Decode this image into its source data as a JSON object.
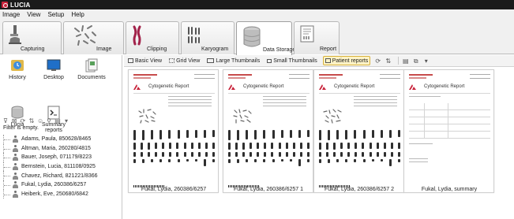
{
  "window": {
    "title": "LUCIA"
  },
  "menu": [
    "Image",
    "View",
    "Setup",
    "Help"
  ],
  "modules": [
    {
      "label": "Capturing",
      "icon": "microscope-icon"
    },
    {
      "label": "Image",
      "icon": "chromosome-spread-icon"
    },
    {
      "label": "Clipping",
      "icon": "chromosome-icon"
    },
    {
      "label": "Karyogram",
      "icon": "karyogram-icon"
    },
    {
      "label": "Data Storage",
      "icon": "database-icon",
      "active": true
    },
    {
      "label": "Report",
      "icon": "report-icon"
    }
  ],
  "toolbar": {
    "views": [
      "Basic View",
      "Grid View",
      "Large Thumbnails",
      "Small Thumbnails",
      "Patient reports"
    ],
    "active_view": "Patient reports"
  },
  "shortcuts": [
    {
      "label": "History",
      "icon": "history-icon"
    },
    {
      "label": "Desktop",
      "icon": "desktop-icon"
    },
    {
      "label": "Documents",
      "icon": "documents-icon"
    },
    {
      "label": "Lucia",
      "icon": "lucia-database-icon"
    },
    {
      "label": "Summary reports",
      "icon": "summary-reports-icon"
    }
  ],
  "filter_status": "Filter is empty.",
  "patients": [
    "Adams, Paula, 850628/8465",
    "Altman, Maria, 260280/4815",
    "Bauer, Joseph, 071179/8223",
    "Bernstein, Lucia, 811108/0925",
    "Chavez, Richard, 821221/8366",
    "Fukal, Lydia, 260386/6257",
    "Heiberk, Eve, 250680/6842"
  ],
  "report_heading": "Cytogenetic Report",
  "reports": [
    {
      "caption": "Fukal, Lydia, 260386/6257",
      "kind": "karyotype"
    },
    {
      "caption": "Fukal, Lydia, 260386/6257 1",
      "kind": "karyotype"
    },
    {
      "caption": "Fukal, Lydia, 260386/6257 2",
      "kind": "karyotype"
    },
    {
      "caption": "Fukal, Lydia, summary",
      "kind": "summary"
    }
  ]
}
